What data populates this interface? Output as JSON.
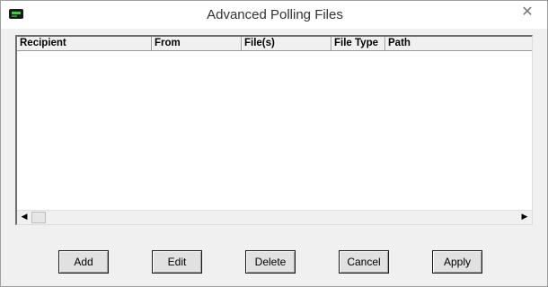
{
  "window": {
    "title": "Advanced Polling Files",
    "icon": "terminal-icon",
    "close_glyph": "✕"
  },
  "table": {
    "columns": [
      "Recipient",
      "From",
      "File(s)",
      "File Type",
      "Path"
    ],
    "rows": []
  },
  "scrollbar": {
    "left_arrow": "◀",
    "right_arrow": "▶"
  },
  "buttons": {
    "add": "Add",
    "edit": "Edit",
    "delete": "Delete",
    "cancel": "Cancel",
    "apply": "Apply"
  }
}
